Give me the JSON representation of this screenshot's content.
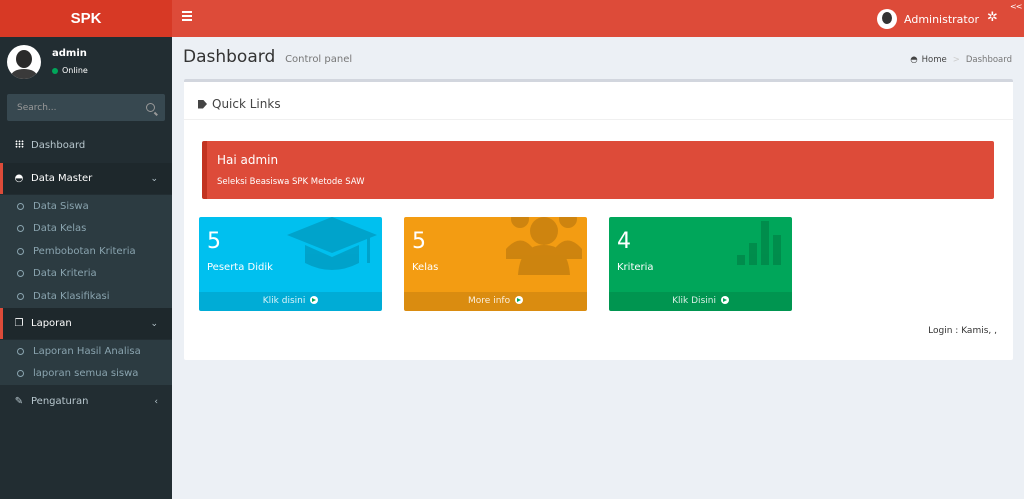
{
  "brand": "SPK",
  "topbar": {
    "username": "Administrator"
  },
  "sidebar": {
    "user": {
      "name": "admin",
      "status": "Online"
    },
    "search_placeholder": "Search...",
    "items": [
      {
        "label": "Dashboard",
        "icon": "th-icon"
      },
      {
        "label": "Data Master",
        "icon": "dashboard-icon"
      },
      {
        "label": "Laporan",
        "icon": "copy-icon"
      },
      {
        "label": "Pengaturan",
        "icon": "wrench-icon"
      }
    ],
    "data_master_sub": [
      "Data Siswa",
      "Data Kelas",
      "Pembobotan Kriteria",
      "Data Kriteria",
      "Data Klasifikasi"
    ],
    "laporan_sub": [
      "Laporan Hasil Analisa",
      "laporan semua siswa"
    ]
  },
  "header": {
    "title": "Dashboard",
    "subtitle": "Control panel"
  },
  "breadcrumb": {
    "home": "Home",
    "current": "Dashboard"
  },
  "box": {
    "title": "Quick Links"
  },
  "alert": {
    "title": "Hai admin",
    "text": "Seleksi Beasiswa SPK Metode SAW"
  },
  "stats": [
    {
      "value": "5",
      "label": "Peserta Didik",
      "link": "Klik disini",
      "color": "#00c0ef",
      "icon": "graduation-cap-icon"
    },
    {
      "value": "5",
      "label": "Kelas",
      "link": "More info",
      "color": "#f39c12",
      "icon": "users-icon"
    },
    {
      "value": "4",
      "label": "Kriteria",
      "link": "Klik Disini",
      "color": "#00a65a",
      "icon": "bar-chart-icon"
    }
  ],
  "login_text": "Login : Kamis, ,"
}
